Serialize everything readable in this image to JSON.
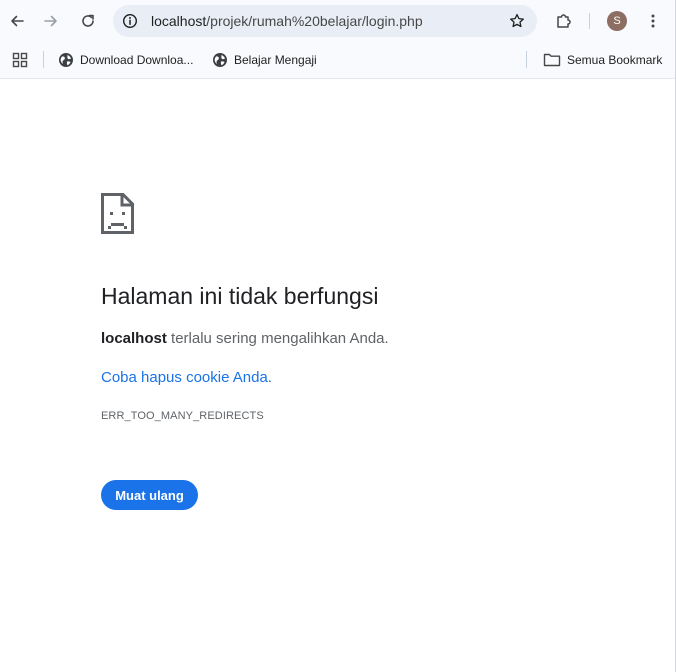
{
  "toolbar": {
    "back_icon": "arrow-left-icon",
    "forward_icon": "arrow-right-icon",
    "reload_icon": "reload-icon",
    "address": {
      "host": "localhost",
      "path": "/projek/rumah%20belajar/login.php"
    },
    "profile_initial": "S",
    "profile_color": "#8d6e63"
  },
  "bookmarks": {
    "items": [
      {
        "label": "Download Downloa..."
      },
      {
        "label": "Belajar Mengaji"
      }
    ],
    "all_bookmarks_label": "Semua Bookmark"
  },
  "error": {
    "title": "Halaman ini tidak berfungsi",
    "host": "localhost",
    "message": " terlalu sering mengalihkan Anda.",
    "suggestion_link": "Coba hapus cookie Anda.",
    "code": "ERR_TOO_MANY_REDIRECTS",
    "reload_button": "Muat ulang"
  },
  "colors": {
    "accent": "#1a73e8",
    "toolbar_bg": "#f8fafd",
    "omnibox_bg": "#e9eef6"
  }
}
